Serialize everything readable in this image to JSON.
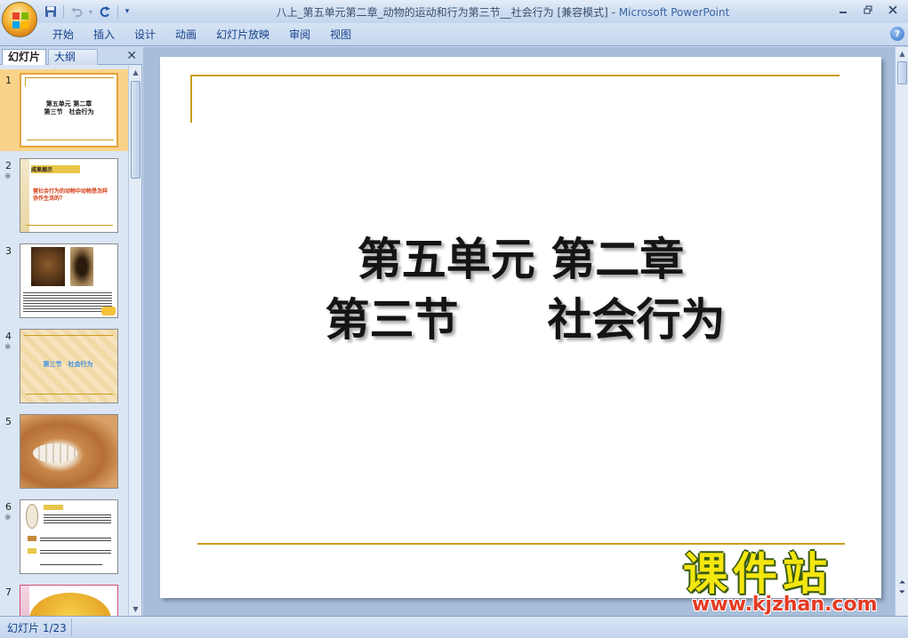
{
  "window": {
    "title_doc": "八上_第五单元第二章_动物的运动和行为第三节__社会行为 [兼容模式]",
    "title_sep": " - ",
    "title_app": "Microsoft PowerPoint"
  },
  "quick_access": {
    "save_icon": "save-icon",
    "undo_icon": "undo-icon",
    "redo_icon": "redo-icon",
    "customize_icon": "customize-qat-icon"
  },
  "ribbon": {
    "tabs": [
      "开始",
      "插入",
      "设计",
      "动画",
      "幻灯片放映",
      "审阅",
      "视图"
    ],
    "help_label": "?"
  },
  "left_pane": {
    "tabs": [
      "幻灯片",
      "大纲"
    ],
    "close_label": "✕",
    "thumbnails": [
      {
        "num": "1",
        "anim": "",
        "text_a": "第五单元 第二章",
        "text_b": "第三节　社会行为"
      },
      {
        "num": "2",
        "anim": "※",
        "text_a": "成果展示",
        "text_b": "营社会行为的动物中动物是怎样协作生活的？"
      },
      {
        "num": "3",
        "anim": "",
        "text_a": "",
        "text_b": ""
      },
      {
        "num": "4",
        "anim": "※",
        "text_a": "第三节　社会行为",
        "text_b": ""
      },
      {
        "num": "5",
        "anim": "",
        "text_a": "",
        "text_b": ""
      },
      {
        "num": "6",
        "anim": "※",
        "text_a": "",
        "text_b": ""
      },
      {
        "num": "7",
        "anim": "",
        "text_a": "",
        "text_b": ""
      }
    ]
  },
  "slide": {
    "title_line1": "第五单元 第二章",
    "title_line2": "第三节　　社会行为"
  },
  "status": {
    "slide_counter": "幻灯片 1/23"
  },
  "watermark": {
    "cn": "课件站",
    "url": "www.kjzhan.com"
  },
  "colors": {
    "accent_gold": "#c99d1e",
    "ribbon_blue": "#15428b",
    "selected_thumb": "#f9d38a"
  }
}
